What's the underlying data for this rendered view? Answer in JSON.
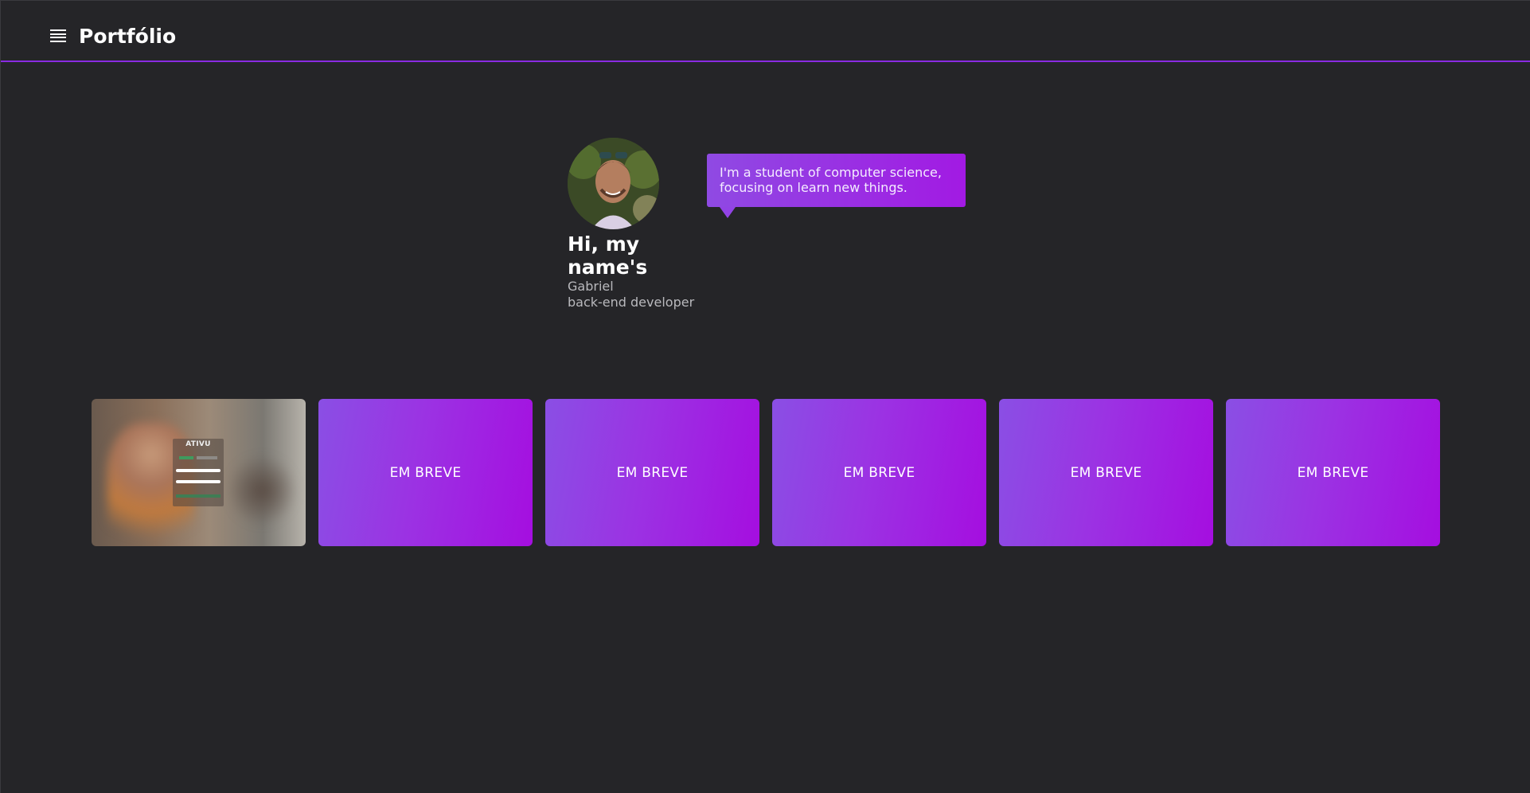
{
  "header": {
    "title": "Portfólio",
    "menu_icon": "hamburger-menu-icon"
  },
  "profile": {
    "greeting": "Hi, my name's",
    "name": "Gabriel",
    "role": "back-end developer",
    "avatar_icon": "profile-photo"
  },
  "bubble": {
    "text": "I'm a student of computer science, focusing on learn new things."
  },
  "projects": {
    "preview_logo": "ATIVU",
    "cards": [
      {
        "label": "EM BREVE"
      },
      {
        "label": "EM BREVE"
      },
      {
        "label": "EM BREVE"
      },
      {
        "label": "EM BREVE"
      },
      {
        "label": "EM BREVE"
      }
    ]
  },
  "colors": {
    "background": "#252528",
    "accent": "#8a2be2",
    "card_gradient_start": "#8a4fe4",
    "card_gradient_end": "#a50ee0"
  }
}
